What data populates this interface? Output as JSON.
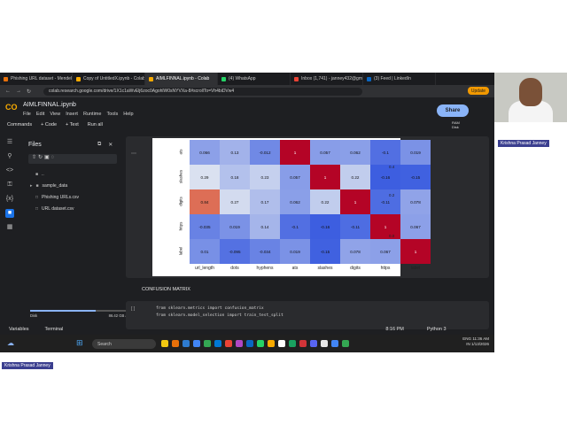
{
  "browser": {
    "tabs": [
      {
        "label": "Phishing URL dataset - Mendele",
        "color": "#e8710a"
      },
      {
        "label": "Copy of UntitledX.ipynb - Colab",
        "color": "#f9ab00"
      },
      {
        "label": "AIMLFINNAL.ipynb - Colab",
        "color": "#f9ab00"
      },
      {
        "label": "(4) WhatsApp",
        "color": "#25d366"
      },
      {
        "label": "Inbox (1,741) - janney432@gm",
        "color": "#ea4335"
      },
      {
        "label": "(3) Feed | LinkedIn",
        "color": "#0a66c2"
      }
    ],
    "url": "colab.research.google.com/drive/1X1c1aWvElj6zoc0AgohlW0sNYVXa-8#scrollTo=Vh4biDVw4",
    "update_label": "Update"
  },
  "colab": {
    "notebook_name": "AIMLFINNAL.ipynb",
    "menu": [
      "File",
      "Edit",
      "View",
      "Insert",
      "Runtime",
      "Tools",
      "Help"
    ],
    "toolbar": [
      "Commands",
      "+ Code",
      "+ Text",
      "Run all"
    ],
    "share_label": "Share",
    "ram_label": "RAM",
    "disk_label": "Disk",
    "files_title": "Files",
    "file_items": [
      "..",
      "sample_data",
      "Phishing URLs.csv",
      "URL dataset.csv"
    ],
    "disk_footer": {
      "label": "Disk",
      "value": "86.42 GB available"
    },
    "section_title": "CONFUSION MATRIX",
    "code_lines": [
      "from sklearn.metrics import confusion_matrix",
      "from sklearn.model_selection import train_test_split"
    ],
    "footer": {
      "variables": "Variables",
      "terminal": "Terminal",
      "time": "8:16 PM",
      "runtime": "Python 3"
    }
  },
  "chart_data": {
    "type": "heatmap",
    "row_labels": [
      "ats",
      "slashes",
      "digits",
      "https",
      "label"
    ],
    "col_labels": [
      "url_length",
      "dots",
      "hyphens",
      "ats",
      "slashes",
      "digits",
      "https",
      "label"
    ],
    "values": [
      [
        "0.066",
        "0.13",
        "-0.012",
        "1",
        "0.057",
        "0.062",
        "-0.1",
        "0.019"
      ],
      [
        "0.29",
        "0.18",
        "0.23",
        "0.057",
        "1",
        "0.22",
        "-0.16",
        "-0.15"
      ],
      [
        "0.84",
        "0.27",
        "0.17",
        "0.062",
        "0.22",
        "1",
        "-0.11",
        "0.078"
      ],
      [
        "-0.035",
        "0.019",
        "0.14",
        "-0.1",
        "-0.16",
        "-0.11",
        "1",
        "0.067"
      ],
      [
        "0.01",
        "-0.095",
        "-0.034",
        "0.019",
        "-0.15",
        "0.078",
        "0.067",
        "1"
      ]
    ],
    "colorbar_ticks": [
      "0.4",
      "0.2",
      "0.0"
    ],
    "colormap": "coolwarm"
  },
  "taskbar": {
    "search_placeholder": "Search",
    "tray_lang": "ENG",
    "tray_region": "IN",
    "clock_time": "11:36 AM",
    "clock_date": "1/13/2026"
  },
  "video": {
    "participant_name": "Krishna Prasad Janney"
  }
}
